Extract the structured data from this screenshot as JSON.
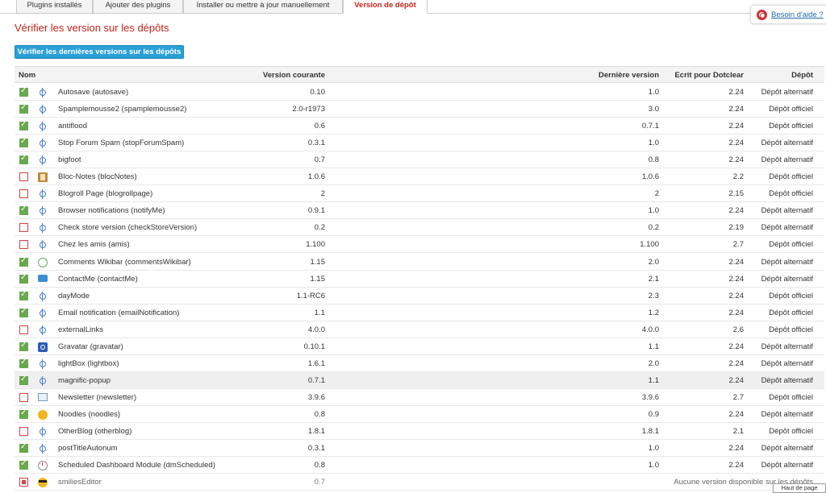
{
  "tabs": [
    "Plugins installés",
    "Ajouter des plugins",
    "Installer ou mettre à jour manuellement",
    "Version de dépôt"
  ],
  "help_link": "Besoin d'aide ?",
  "page_title": "Vérifier les version sur les dépôts",
  "check_button": "Vérifier les dernières versions sur les dépôts",
  "columns": {
    "name": "Nom",
    "current": "Version courante",
    "latest": "Dernière version",
    "written_for": "Ecrit pour Dotclear",
    "repo": "Dépôt"
  },
  "rows": [
    {
      "checked": true,
      "icon": "plug-icon",
      "name": "Autosave (autosave)",
      "current": "0.10",
      "latest": "1.0",
      "dc": "2.24",
      "repo": "Dépôt alternatif"
    },
    {
      "checked": true,
      "icon": "plug-icon",
      "name": "Spamplemousse2 (spamplemousse2)",
      "current": "2.0-r1973",
      "latest": "3.0",
      "dc": "2.24",
      "repo": "Dépôt officiel"
    },
    {
      "checked": true,
      "icon": "plug-icon",
      "name": "antiflood",
      "current": "0.6",
      "latest": "0.7.1",
      "dc": "2.24",
      "repo": "Dépôt officiel"
    },
    {
      "checked": true,
      "icon": "plug-icon",
      "name": "Stop Forum Spam (stopForumSpam)",
      "current": "0.3.1",
      "latest": "1.0",
      "dc": "2.24",
      "repo": "Dépôt alternatif"
    },
    {
      "checked": true,
      "icon": "plug-icon",
      "name": "bigfoot",
      "current": "0.7",
      "latest": "0.8",
      "dc": "2.24",
      "repo": "Dépôt alternatif"
    },
    {
      "checked": false,
      "icon": "notes-icon",
      "name": "Bloc-Notes (blocNotes)",
      "current": "1.0.6",
      "latest": "1.0.6",
      "dc": "2.2",
      "repo": "Dépôt officiel"
    },
    {
      "checked": false,
      "icon": "plug-icon",
      "name": "Blogroll Page (blogrollpage)",
      "current": "2",
      "latest": "2",
      "dc": "2.15",
      "repo": "Dépôt officiel"
    },
    {
      "checked": true,
      "icon": "plug-icon",
      "name": "Browser notifications (notifyMe)",
      "current": "0.9.1",
      "latest": "1.0",
      "dc": "2.24",
      "repo": "Dépôt alternatif"
    },
    {
      "checked": false,
      "icon": "plug-icon",
      "name": "Check store version (checkStoreVersion)",
      "current": "0.2",
      "latest": "0.2",
      "dc": "2.19",
      "repo": "Dépôt alternatif"
    },
    {
      "checked": false,
      "icon": "plug-icon",
      "name": "Chez les amis (amis)",
      "current": "1.100",
      "latest": "1.100",
      "dc": "2.7",
      "repo": "Dépôt officiel"
    },
    {
      "checked": true,
      "icon": "bubble-icon",
      "name": "Comments Wikibar (commentsWikibar)",
      "current": "1.15",
      "latest": "2.0",
      "dc": "2.24",
      "repo": "Dépôt alternatif"
    },
    {
      "checked": true,
      "icon": "mail-icon",
      "name": "ContactMe (contactMe)",
      "current": "1.15",
      "latest": "2.1",
      "dc": "2.24",
      "repo": "Dépôt alternatif"
    },
    {
      "checked": true,
      "icon": "plug-icon",
      "name": "dayMode",
      "current": "1.1-RC6",
      "latest": "2.3",
      "dc": "2.24",
      "repo": "Dépôt officiel"
    },
    {
      "checked": true,
      "icon": "plug-icon",
      "name": "Email notification (emailNotification)",
      "current": "1.1",
      "latest": "1.2",
      "dc": "2.24",
      "repo": "Dépôt officiel"
    },
    {
      "checked": false,
      "icon": "plug-icon",
      "name": "externalLinks",
      "current": "4.0.0",
      "latest": "4.0.0",
      "dc": "2.6",
      "repo": "Dépôt officiel"
    },
    {
      "checked": true,
      "icon": "gravatar-icon",
      "name": "Gravatar (gravatar)",
      "current": "0.10.1",
      "latest": "1.1",
      "dc": "2.24",
      "repo": "Dépôt alternatif"
    },
    {
      "checked": true,
      "icon": "plug-icon",
      "name": "lightBox (lightbox)",
      "current": "1.6.1",
      "latest": "2.0",
      "dc": "2.24",
      "repo": "Dépôt alternatif"
    },
    {
      "checked": true,
      "icon": "plug-icon",
      "name": "magnific-popup",
      "current": "0.7.1",
      "latest": "1.1",
      "dc": "2.24",
      "repo": "Dépôt alternatif",
      "highlight": true
    },
    {
      "checked": false,
      "icon": "newsletter-icon",
      "name": "Newsletter (newsletter)",
      "current": "3.9.6",
      "latest": "3.9.6",
      "dc": "2.7",
      "repo": "Dépôt officiel"
    },
    {
      "checked": true,
      "icon": "smiley-icon",
      "name": "Noodles (noodles)",
      "current": "0.8",
      "latest": "0.9",
      "dc": "2.24",
      "repo": "Dépôt alternatif"
    },
    {
      "checked": false,
      "icon": "plug-icon",
      "name": "OtherBlog (otherblog)",
      "current": "1.8.1",
      "latest": "1.8.1",
      "dc": "2.1",
      "repo": "Dépôt officiel"
    },
    {
      "checked": true,
      "icon": "plug-icon",
      "name": "postTitleAutonum",
      "current": "0.3.1",
      "latest": "1.0",
      "dc": "2.24",
      "repo": "Dépôt alternatif"
    },
    {
      "checked": true,
      "icon": "clock-icon",
      "name": "Scheduled Dashboard Module (dmScheduled)",
      "current": "0.8",
      "latest": "1.0",
      "dc": "2.24",
      "repo": "Dépôt alternatif"
    }
  ],
  "disabled_row": {
    "icon": "sunglasses-smiley-icon",
    "name": "smiliesEditor",
    "current": "0.7",
    "message": "Aucune version disponible sur les dépôts"
  },
  "back_to_top": "Haut de page"
}
